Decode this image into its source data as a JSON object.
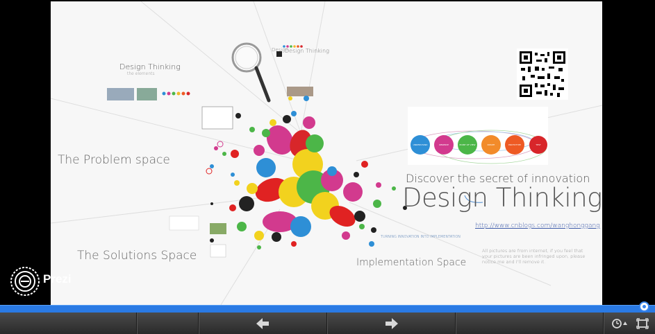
{
  "canvas": {
    "labels": {
      "problem_space": "The Problem space",
      "solutions_space": "The Solutions Space",
      "implementation_space": "Implementation Space",
      "discover": "Discover the secret of innovation",
      "design_thinking": "Design Thinking",
      "url": "http://www.cnblogs.com/wanghonggang",
      "note": "All pictures are from internet, if you feel that your pictures are been infringed upon, please notice me and I'll remove it.",
      "design_thinking_small": "Design Thinking",
      "design_thinking_sub": "the elements",
      "design_thinking_tiny": "Design Thinking",
      "tiny_design": "Design",
      "ideas_text": "TURNING INNOVATION INTO IMPLEMENTATION"
    },
    "process_steps": [
      "UNDERSTAND",
      "OBSERVE",
      "POINT OF VIEW",
      "IDEATE",
      "PROTOTYPE",
      "TEST"
    ],
    "colors": {
      "step_blue": "#2e8fd6",
      "step_pink": "#d23a8e",
      "step_green": "#4cb648",
      "step_orange": "#f28b2a",
      "step_orange2": "#ee5a24",
      "step_red": "#d8262a",
      "url_blue": "#3a58a8"
    }
  },
  "brand": {
    "logo_icon": "prezi-logo-icon",
    "logo_text": "Prezi"
  },
  "player": {
    "progress_percent": 100,
    "progress_color": "#2a7ae4",
    "prev_icon": "arrow-left-icon",
    "next_icon": "arrow-right-icon",
    "autoplay_icon": "autoplay-clock-icon",
    "fullscreen_icon": "fullscreen-icon"
  }
}
